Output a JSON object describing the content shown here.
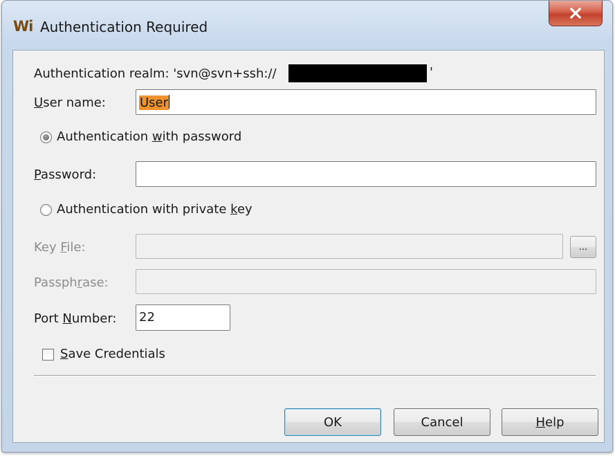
{
  "window": {
    "title": "Authentication Required",
    "app_icon_text": "Wi",
    "close_icon": "close-x-icon"
  },
  "realm": {
    "label": "Authentication realm: 'svn@svn+ssh://",
    "redacted": true,
    "end_char": "'"
  },
  "user": {
    "label_prefix": "",
    "label_mnemonic": "U",
    "label_rest": "ser name:",
    "value": "User"
  },
  "auth_password": {
    "label_prefix": "Authentication ",
    "label_mnemonic": "w",
    "label_rest": "ith password",
    "selected": true
  },
  "password": {
    "label_mnemonic": "P",
    "label_rest": "assword:",
    "value": ""
  },
  "auth_key": {
    "label_prefix": "Authentication with private ",
    "label_mnemonic": "k",
    "label_rest": "ey",
    "selected": false
  },
  "key_file": {
    "label_prefix": "Key ",
    "label_mnemonic": "F",
    "label_rest": "ile:",
    "value": "",
    "browse_label": "...",
    "enabled": false
  },
  "passphrase": {
    "label_prefix": "Passph",
    "label_mnemonic": "r",
    "label_rest": "ase:",
    "value": "",
    "enabled": false
  },
  "port": {
    "label_prefix": "Port ",
    "label_mnemonic": "N",
    "label_rest": "umber:",
    "value": "22"
  },
  "save_credentials": {
    "label_mnemonic": "S",
    "label_rest": "ave Credentials",
    "checked": false
  },
  "buttons": {
    "ok": "OK",
    "cancel": "Cancel",
    "help_mnemonic": "H",
    "help_rest": "elp"
  }
}
